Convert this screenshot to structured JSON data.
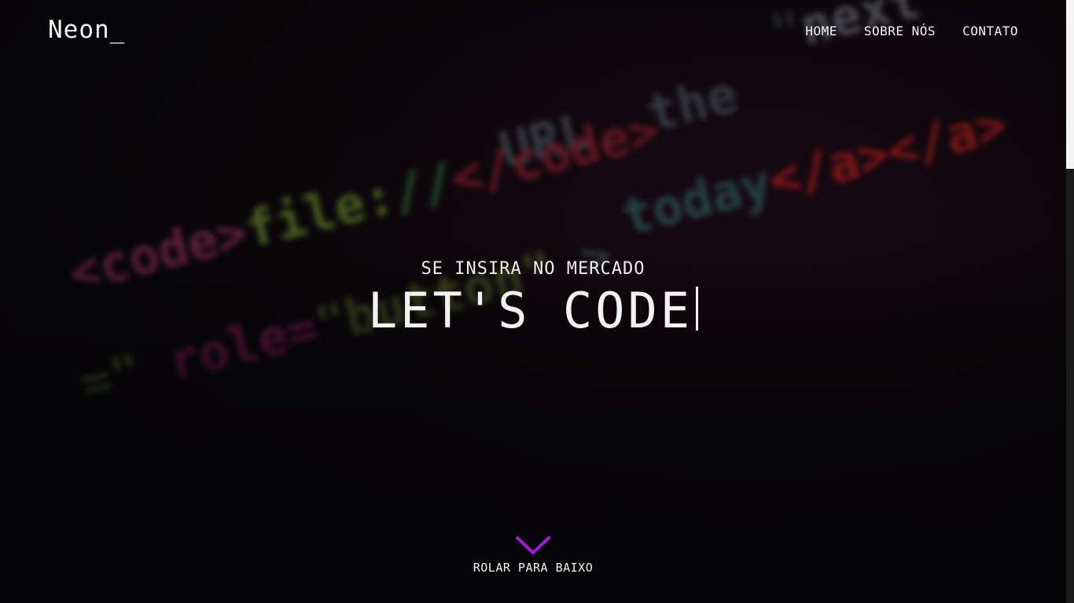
{
  "header": {
    "logo": "Neon_",
    "nav": [
      {
        "label": "HOME"
      },
      {
        "label": "SOBRE NÓS"
      },
      {
        "label": "CONTATO"
      }
    ]
  },
  "hero": {
    "subtitle": "SE INSIRA NO MERCADO",
    "title": "LET'S CODE"
  },
  "scroll": {
    "label": "ROLAR PARA BAIXO",
    "icon": "chevron-down-icon"
  },
  "colors": {
    "accent": "#a21bd6",
    "background": "#050406",
    "text": "#f2f2f2"
  }
}
